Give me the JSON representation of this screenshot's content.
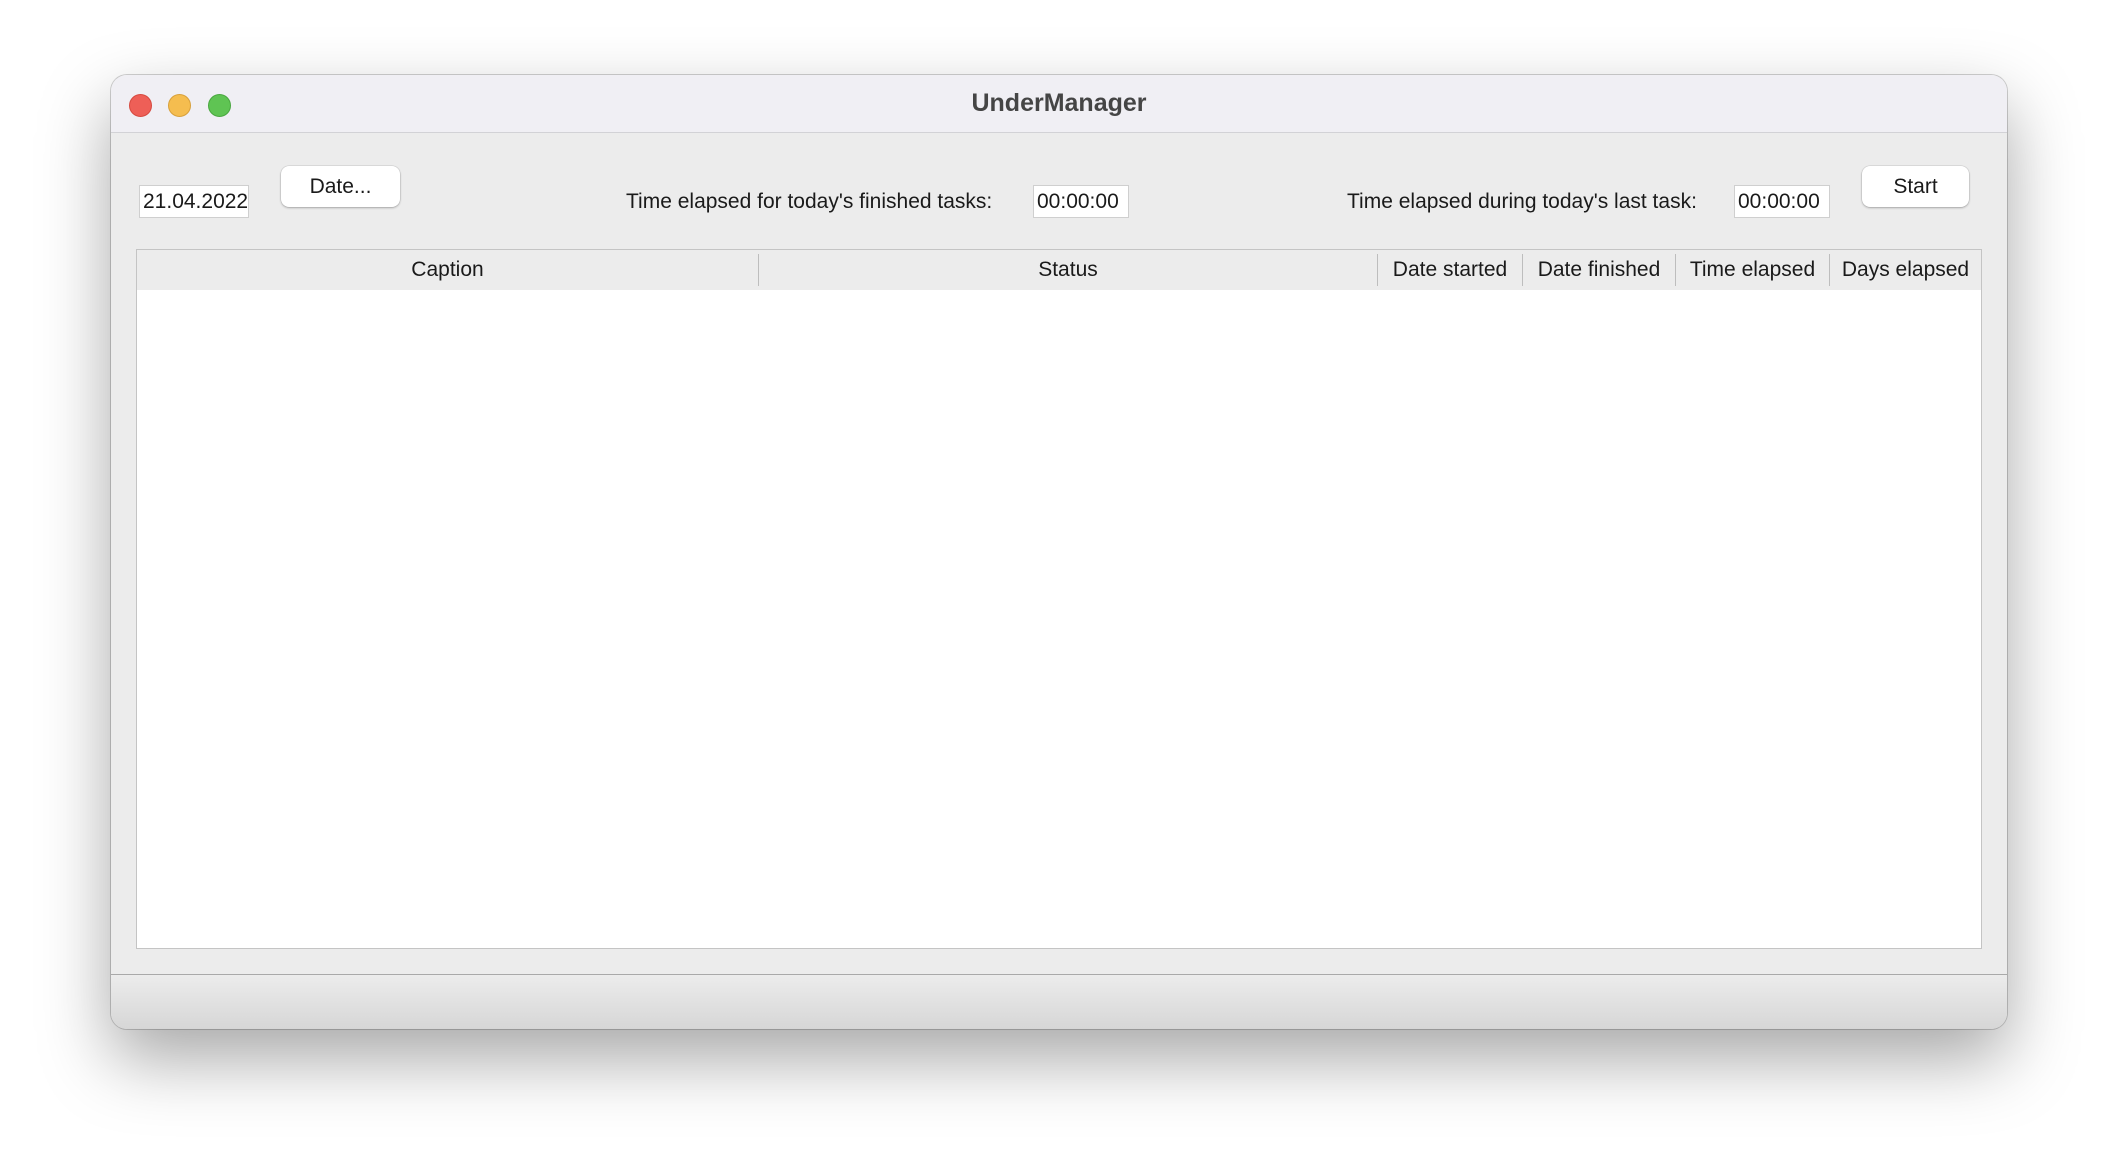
{
  "window": {
    "title": "UnderManager"
  },
  "toolbar": {
    "date_value": "21.04.2022",
    "date_button_label": "Date...",
    "finished_label": "Time elapsed for today's finished tasks:",
    "finished_value": "00:00:00",
    "last_task_label": "Time elapsed during today's last task:",
    "last_task_value": "00:00:00",
    "start_button_label": "Start"
  },
  "table": {
    "columns": [
      "Caption",
      "Status",
      "Date started",
      "Date finished",
      "Time elapsed",
      "Days elapsed"
    ],
    "rows": []
  },
  "colors": {
    "close": "#ee5f57",
    "minimize": "#f5bd4f",
    "zoom": "#5fc453",
    "window_bg": "#ececec",
    "table_bg": "#ffffff"
  }
}
